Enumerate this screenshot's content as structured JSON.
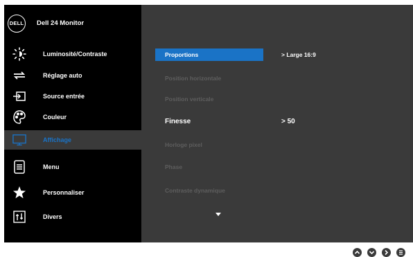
{
  "monitor": {
    "logo_text": "DELL",
    "model": "Dell 24 Monitor"
  },
  "menu": {
    "items": [
      {
        "key": "brightness",
        "label": "Luminosité/Contraste",
        "icon": "brightness-icon"
      },
      {
        "key": "auto",
        "label": "Réglage auto",
        "icon": "auto-adjust-icon"
      },
      {
        "key": "input",
        "label": "Source entrée",
        "icon": "input-source-icon"
      },
      {
        "key": "color",
        "label": "Couleur",
        "icon": "color-palette-icon"
      },
      {
        "key": "display",
        "label": "Affichage",
        "icon": "display-icon",
        "selected": true
      },
      {
        "key": "menu",
        "label": "Menu",
        "icon": "menu-icon"
      },
      {
        "key": "personalize",
        "label": "Personnaliser",
        "icon": "star-icon"
      },
      {
        "key": "others",
        "label": "Divers",
        "icon": "others-icon"
      }
    ]
  },
  "submenu": {
    "items": [
      {
        "label": "Proportions",
        "value": "> Large 16:9",
        "state": "selected"
      },
      {
        "label": "Position horizontale",
        "value": "",
        "state": "disabled"
      },
      {
        "label": "Position verticale",
        "value": "",
        "state": "disabled"
      },
      {
        "label": "Finesse",
        "value": ">  50",
        "state": "active"
      },
      {
        "label": "Horloge pixel",
        "value": "",
        "state": "disabled"
      },
      {
        "label": "Phase",
        "value": "",
        "state": "disabled"
      },
      {
        "label": "Contraste dynamique",
        "value": "",
        "state": "disabled"
      }
    ]
  },
  "colors": {
    "accent": "#1a73c6",
    "panel_left": "#000000",
    "panel_right": "#3a3a3a",
    "disabled_text": "#5e5e5e"
  },
  "nav_buttons": [
    "up-icon",
    "down-icon",
    "right-icon",
    "exit-icon"
  ]
}
